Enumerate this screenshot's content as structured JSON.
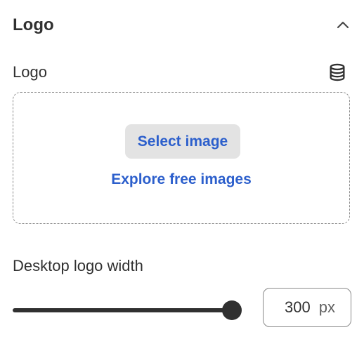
{
  "section": {
    "title": "Logo"
  },
  "logo_field": {
    "label": "Logo",
    "select_button": "Select image",
    "explore_link": "Explore free images"
  },
  "width_field": {
    "label": "Desktop logo width",
    "value": "300",
    "unit": "px",
    "slider_fraction": 1.0
  },
  "colors": {
    "text": "#303030",
    "link": "#2c5fcc",
    "button_bg": "#e3e3e3",
    "border": "#8a8a8a"
  },
  "icons": {
    "collapse": "chevron-up-icon",
    "source": "database-icon"
  }
}
